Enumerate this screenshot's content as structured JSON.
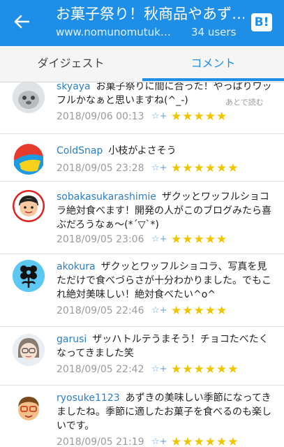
{
  "header": {
    "title": "お菓子祭り！秋商品やあず…",
    "url": "www.nomunomutuk…",
    "users": "34 users",
    "hatena_label": "B!"
  },
  "tabs": [
    {
      "label": "ダイジェスト"
    },
    {
      "label": "コメント"
    }
  ],
  "read_later": "あとで読む",
  "comments": [
    {
      "user": "skyaya",
      "text": "お菓子祭りに間に合った！やっぱりワッフルかなぁと思いますね(^_-)",
      "date": "2018/09/06 00:13",
      "stars": "★★★★★"
    },
    {
      "user": "ColdSnap",
      "text": "小枝がよさそう",
      "date": "2018/09/05 23:28",
      "stars": "★★★★★★"
    },
    {
      "user": "sobakasukarashimie",
      "text": "ザクッとワッフルショコラ絶対食べます！開発の人がこのブログみたら喜ぶだろうなぁ〜(*´▽`*)",
      "date": "2018/09/05 23:06",
      "stars": "★★★★★"
    },
    {
      "user": "akokura",
      "text": "ザクッとワッフルショコラ、写真を見ただけで食べづらさが十分わかりました。でもこれ絶対美味しい！絶対食べたい^o^",
      "date": "2018/09/05 22:46",
      "stars": "★★★★★"
    },
    {
      "user": "garusi",
      "text": "ザッハトルテうまそう！チョコたべたくなってきました笑",
      "date": "2018/09/05 22:42",
      "stars": "★★★★★★"
    },
    {
      "user": "ryosuke1123",
      "text": "あずきの美味しい季節になってきましたね。季節に適したお菓子を食べるのも楽しいです。",
      "date": "2018/09/05 21:19",
      "stars": "★★★★★★"
    }
  ]
}
